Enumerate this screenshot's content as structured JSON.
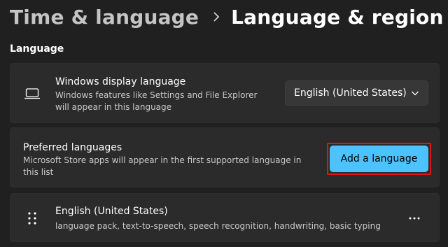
{
  "breadcrumb": {
    "parent": "Time & language",
    "separator_icon": "chevron-right-icon",
    "current": "Language & region"
  },
  "section": {
    "label": "Language"
  },
  "display_language": {
    "icon": "monitor-icon",
    "title": "Windows display language",
    "description": "Windows features like Settings and File Explorer will appear in this language",
    "selected": "English (United States)",
    "dropdown_icon": "chevron-down-icon"
  },
  "preferred_languages": {
    "title": "Preferred languages",
    "description": "Microsoft Store apps will appear in the first supported language in this list",
    "add_button_label": "Add a language",
    "highlight_color": "#e0141c",
    "accent_color": "#4cc2ff"
  },
  "language_list": [
    {
      "name": "English (United States)",
      "features": "language pack, text-to-speech, speech recognition, handwriting, basic typing",
      "drag_icon": "drag-handle-icon",
      "more_icon": "more-options-icon"
    }
  ]
}
